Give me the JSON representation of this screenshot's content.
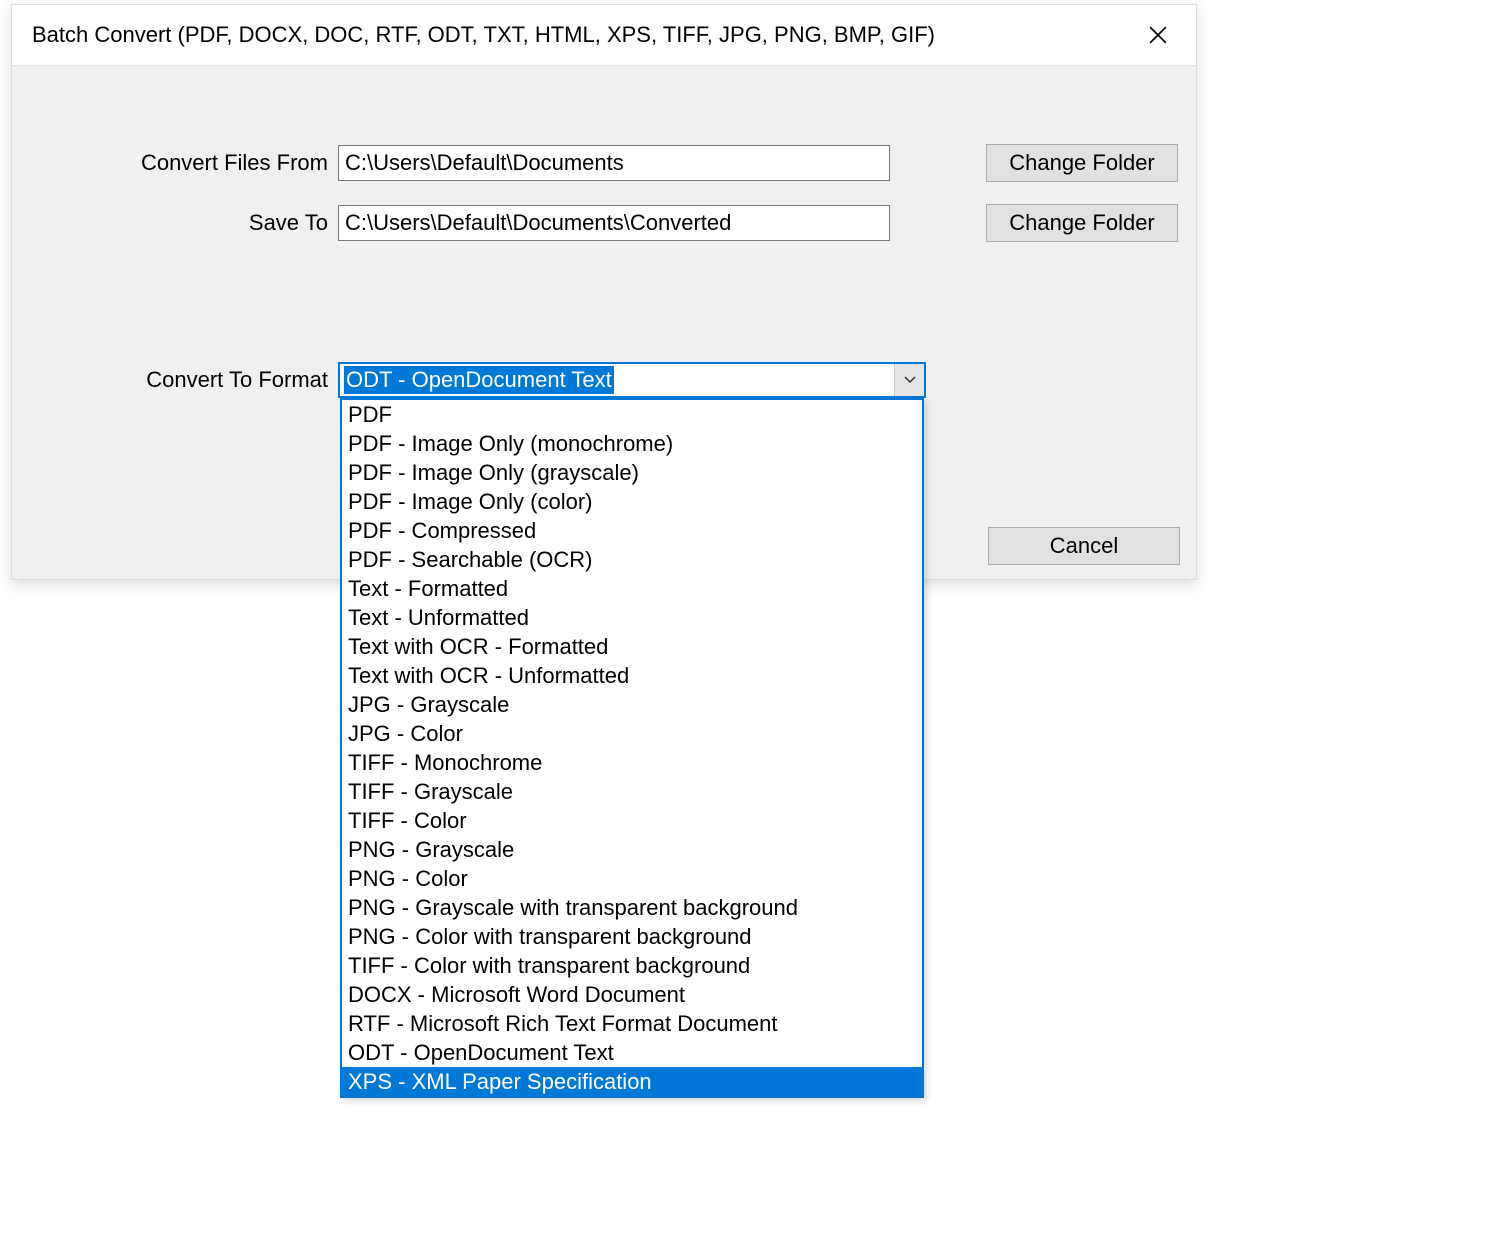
{
  "dialog": {
    "title": "Batch Convert (PDF, DOCX, DOC, RTF, ODT, TXT, HTML, XPS, TIFF, JPG, PNG, BMP, GIF)"
  },
  "labels": {
    "convert_files_from": "Convert Files From",
    "save_to": "Save To",
    "convert_to_format": "Convert To Format"
  },
  "inputs": {
    "from_path": "C:\\Users\\Default\\Documents",
    "save_to_path": "C:\\Users\\Default\\Documents\\Converted"
  },
  "buttons": {
    "change_folder": "Change Folder",
    "cancel": "Cancel"
  },
  "combo": {
    "selected": "ODT - OpenDocument Text",
    "highlighted_index": 23,
    "options": [
      "PDF",
      "PDF - Image Only (monochrome)",
      "PDF - Image Only (grayscale)",
      "PDF - Image Only (color)",
      "PDF - Compressed",
      "PDF - Searchable (OCR)",
      "Text - Formatted",
      "Text - Unformatted",
      "Text with OCR - Formatted",
      "Text with OCR - Unformatted",
      "JPG - Grayscale",
      "JPG - Color",
      "TIFF - Monochrome",
      "TIFF - Grayscale",
      "TIFF - Color",
      "PNG - Grayscale",
      "PNG - Color",
      "PNG - Grayscale with transparent background",
      "PNG - Color with transparent background",
      "TIFF - Color with transparent background",
      "DOCX - Microsoft Word Document",
      "RTF - Microsoft Rich Text Format Document",
      "ODT - OpenDocument Text",
      "XPS - XML Paper Specification"
    ]
  }
}
